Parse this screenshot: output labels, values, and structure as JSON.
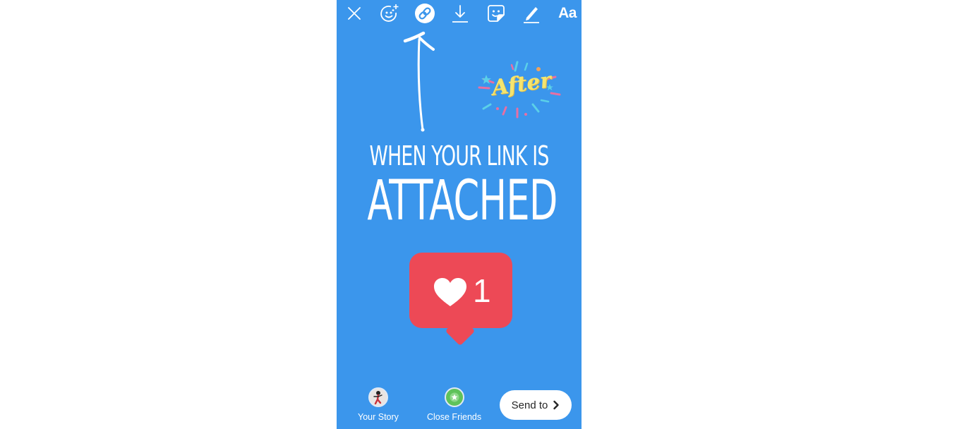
{
  "colors": {
    "background": "#3b96ec",
    "like_bubble": "#ed4956",
    "sticker_text": "#f4e56f",
    "close_friends": "#5fc25a"
  },
  "toolbar": {
    "items": [
      {
        "icon": "close-icon"
      },
      {
        "icon": "face-effects-icon"
      },
      {
        "icon": "link-icon",
        "active": true
      },
      {
        "icon": "download-icon"
      },
      {
        "icon": "sticker-icon"
      },
      {
        "icon": "draw-icon"
      },
      {
        "icon": "text-icon",
        "label": "Aa"
      }
    ]
  },
  "canvas": {
    "sticker_text": "After",
    "headline_line1": "WHEN YOUR LINK IS",
    "headline_line2": "ATTACHED",
    "like_count": "1"
  },
  "share": {
    "your_story_label": "Your Story",
    "close_friends_label": "Close Friends",
    "send_label": "Send to"
  }
}
